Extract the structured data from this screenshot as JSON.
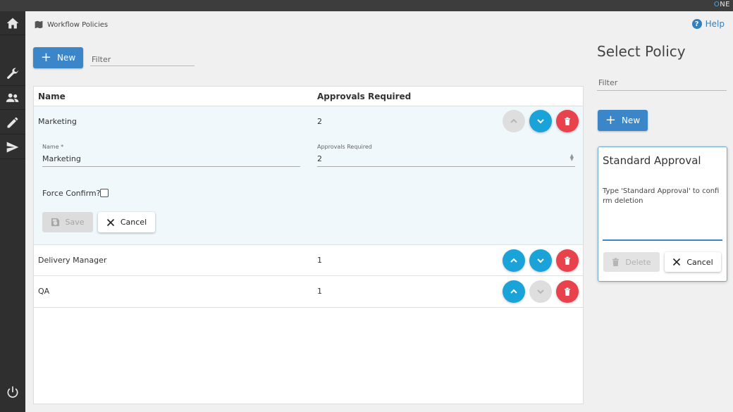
{
  "brand": {
    "o": "O",
    "rest": "NE"
  },
  "breadcrumb": {
    "title": "Workflow Policies"
  },
  "help": {
    "label": "Help",
    "glyph": "?"
  },
  "toolbar": {
    "new_label": "New",
    "filter_placeholder": "Filter"
  },
  "table": {
    "columns": [
      "Name",
      "Approvals Required"
    ],
    "rows": [
      {
        "name": "Marketing",
        "approvals": "2"
      },
      {
        "name": "Delivery Manager",
        "approvals": "1"
      },
      {
        "name": "QA",
        "approvals": "1"
      }
    ]
  },
  "edit_form": {
    "name_label": "Name *",
    "name_value": "Marketing",
    "approvals_label": "Approvals Required",
    "approvals_value": "2",
    "force_confirm_label": "Force Confirm?",
    "save_label": "Save",
    "cancel_label": "Cancel"
  },
  "right_panel": {
    "title": "Select Policy",
    "filter_placeholder": "Filter",
    "new_label": "New"
  },
  "delete_dialog": {
    "title": "Standard Approval",
    "message": "Type 'Standard Approval' to confirm deletion",
    "delete_label": "Delete",
    "cancel_label": "Cancel"
  },
  "colors": {
    "primary": "#3a86c8",
    "round_button": "#1aa3d8",
    "danger": "#e8434d",
    "disabled": "#dedede"
  },
  "icons": [
    "home-icon",
    "wrench-icon",
    "users-icon",
    "pencil-icon",
    "send-icon",
    "power-icon",
    "map-icon",
    "help-icon",
    "plus-icon",
    "chevron-up-icon",
    "chevron-down-icon",
    "trash-icon",
    "save-icon",
    "close-icon"
  ]
}
